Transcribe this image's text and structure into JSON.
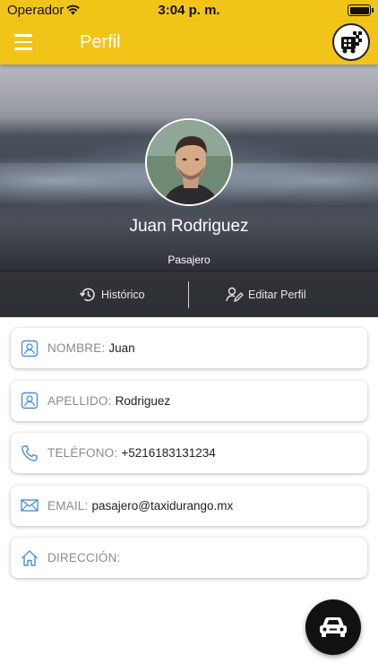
{
  "status_bar": {
    "carrier": "Operador",
    "time": "3:04 p. m."
  },
  "app_bar": {
    "title": "Perfil",
    "menu_icon": "hamburger-menu-icon",
    "logo_icon": "taxi-brand-logo"
  },
  "profile": {
    "name": "Juan Rodriguez",
    "role": "Pasajero",
    "actions": {
      "history_label": "Histórico",
      "edit_label": "Editar Perfil"
    }
  },
  "fields": [
    {
      "label": "NOMBRE:",
      "value": "Juan",
      "icon": "contact-icon"
    },
    {
      "label": "APELLIDO:",
      "value": "Rodriguez",
      "icon": "contact-icon"
    },
    {
      "label": "TELÉFONO:",
      "value": "+5216183131234",
      "icon": "phone-icon"
    },
    {
      "label": "EMAIL:",
      "value": "pasajero@taxidurango.mx",
      "icon": "mail-icon"
    },
    {
      "label": "DIRECCIÓN:",
      "value": "",
      "icon": "home-icon"
    }
  ],
  "fab": {
    "icon": "car-icon"
  },
  "colors": {
    "accent": "#f3c418",
    "icon_blue": "#4a90d9",
    "label_gray": "#8a8a8a"
  }
}
